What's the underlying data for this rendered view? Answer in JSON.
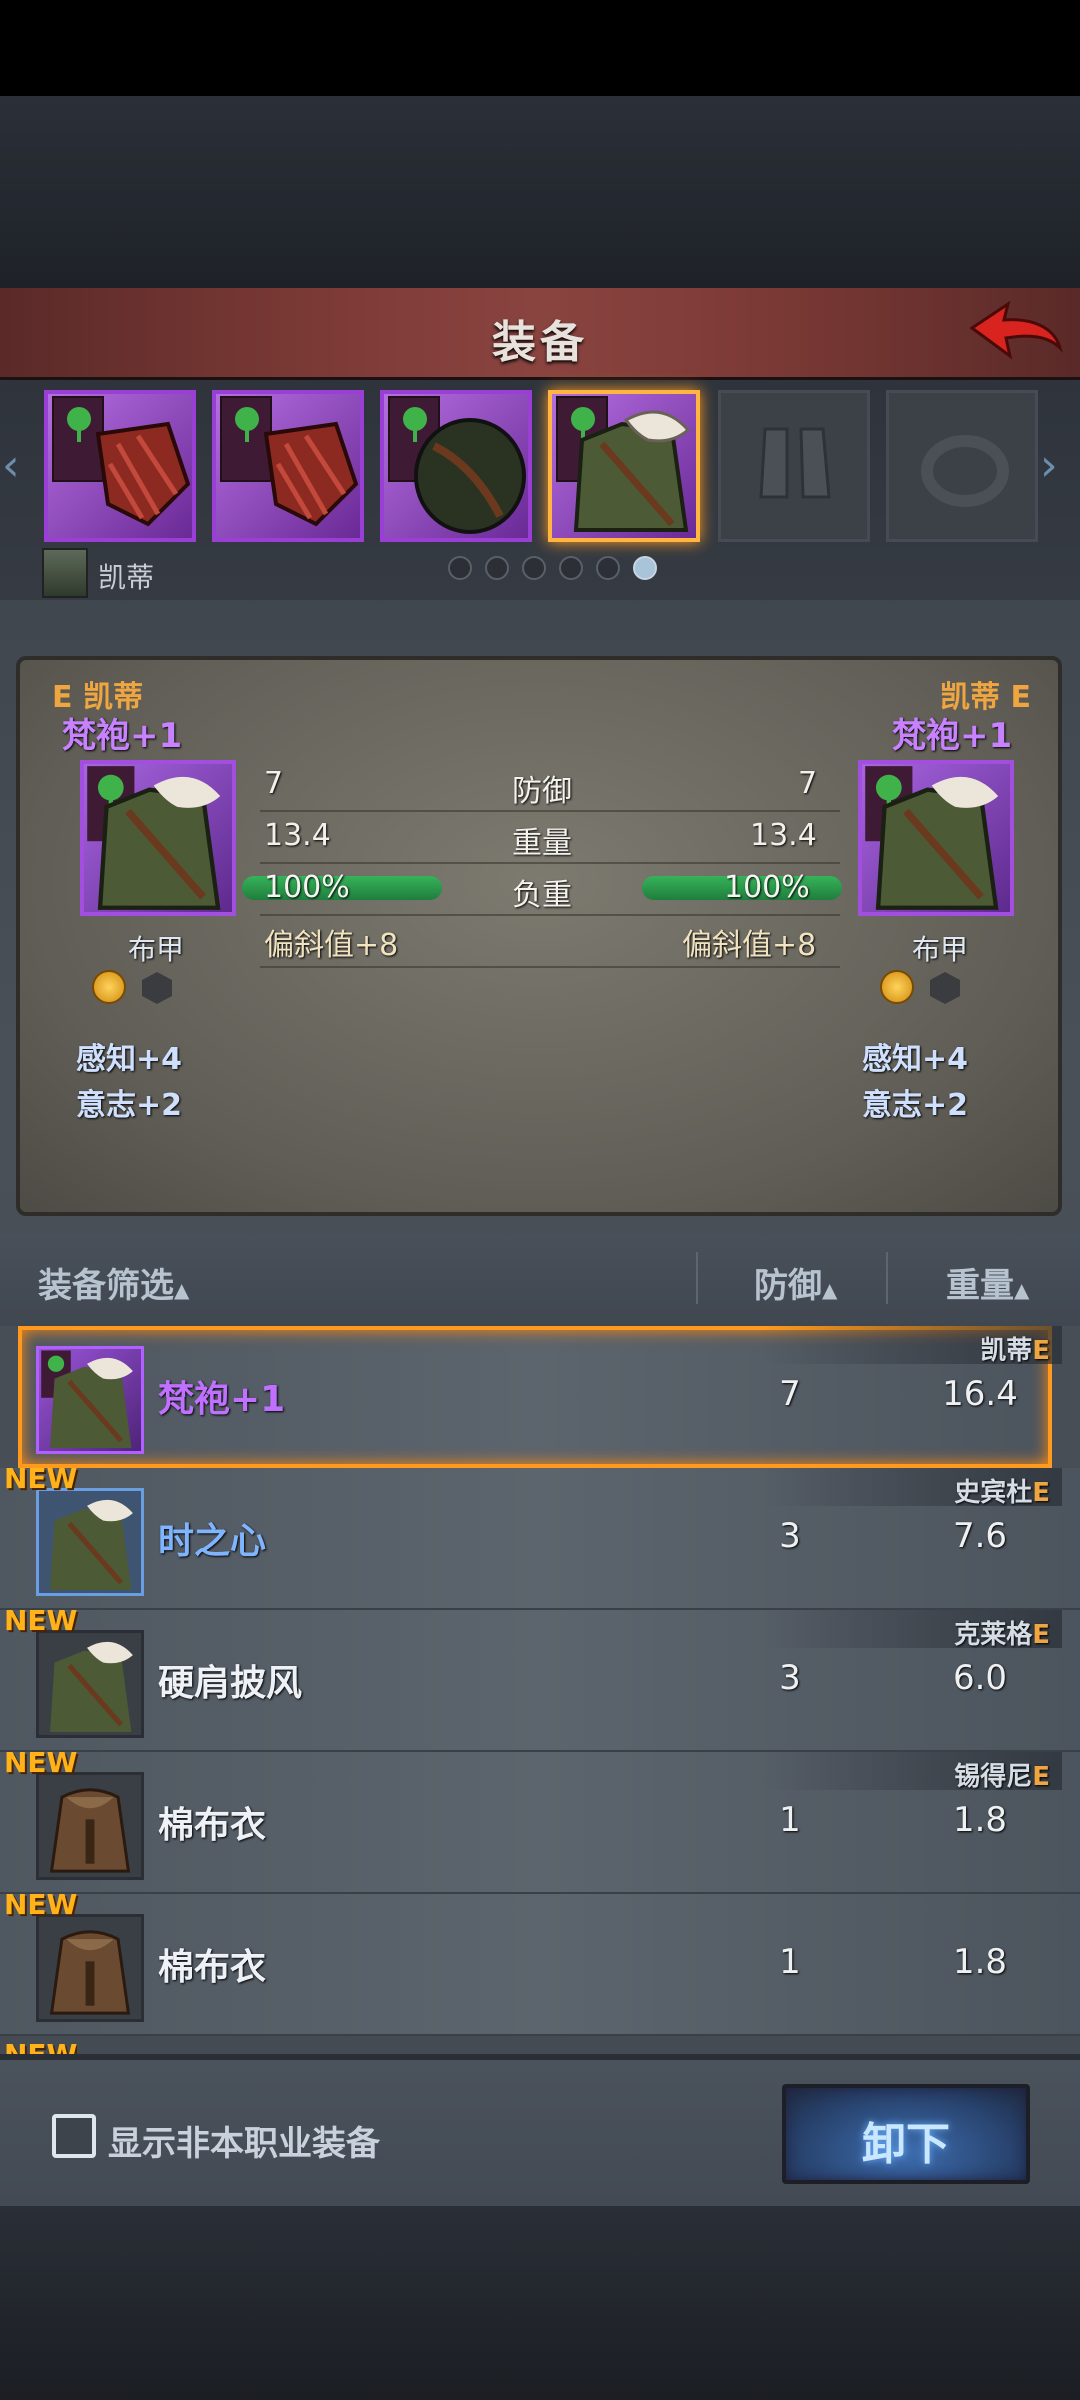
{
  "screen": {
    "title": "装备"
  },
  "slots": [
    {
      "icon": "claw-gauntlet-icon",
      "state": "equipped"
    },
    {
      "icon": "claw-gauntlet-icon",
      "state": "equipped"
    },
    {
      "icon": "leather-sack-icon",
      "state": "equipped"
    },
    {
      "icon": "fur-robe-icon",
      "state": "selected"
    },
    {
      "icon": "boots-icon",
      "state": "empty"
    },
    {
      "icon": "ring-icon",
      "state": "empty"
    }
  ],
  "owner": {
    "name": "凯蒂",
    "page_count": 6,
    "page_active": 6
  },
  "compare": {
    "left": {
      "tag_e": "E",
      "owner": "凯蒂",
      "item_name": "梵袍+1",
      "type": "布甲",
      "attr1": "感知+4",
      "attr2": "意志+2",
      "defense": "7",
      "weight": "13.4",
      "load": "100%",
      "deflect": "偏斜值+8"
    },
    "right": {
      "tag_e": "E",
      "owner": "凯蒂",
      "item_name": "梵袍+1",
      "type": "布甲",
      "attr1": "感知+4",
      "attr2": "意志+2",
      "defense": "7",
      "weight": "13.4",
      "load": "100%",
      "deflect": "偏斜值+8"
    },
    "labels": {
      "defense": "防御",
      "weight": "重量",
      "load": "负重"
    }
  },
  "list": {
    "headers": {
      "filter": "装备筛选",
      "defense": "防御",
      "weight": "重量",
      "sort_glyph": "▲"
    },
    "rows": [
      {
        "name": "梵袍+1",
        "defense": "7",
        "weight": "16.4",
        "owner": "凯蒂",
        "owner_e": "E",
        "is_new": false,
        "rarity": "purple",
        "selected": true
      },
      {
        "name": "时之心",
        "defense": "3",
        "weight": "7.6",
        "owner": "史宾杜",
        "owner_e": "E",
        "is_new": true,
        "rarity": "blue",
        "selected": false
      },
      {
        "name": "硬肩披风",
        "defense": "3",
        "weight": "6.0",
        "owner": "克莱格",
        "owner_e": "E",
        "is_new": true,
        "rarity": "common",
        "selected": false
      },
      {
        "name": "棉布衣",
        "defense": "1",
        "weight": "1.8",
        "owner": "锡得尼",
        "owner_e": "E",
        "is_new": true,
        "rarity": "common",
        "selected": false
      },
      {
        "name": "棉布衣",
        "defense": "1",
        "weight": "1.8",
        "owner": "",
        "owner_e": "",
        "is_new": true,
        "rarity": "common",
        "selected": false
      }
    ],
    "new_label": "NEW"
  },
  "bottom": {
    "checkbox_label": "显示非本职业装备",
    "checkbox_checked": false,
    "unequip_label": "卸下"
  },
  "colors": {
    "accent_orange": "#f0a640",
    "rarity_purple": "#c070ff",
    "rarity_blue": "#7fb4ff",
    "header_red": "#7c3a36"
  }
}
